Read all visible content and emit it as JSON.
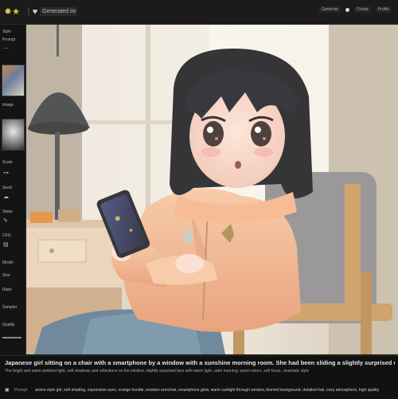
{
  "topbar": {
    "title": "Generated image",
    "right_items": [
      "Generate",
      "Create",
      "Profile"
    ]
  },
  "sidebar": {
    "labels": [
      "Style",
      "Prompt",
      "Image",
      "Scale",
      "Seed",
      "Steps",
      "CFG",
      "Model",
      "Size",
      "Ratio",
      "Sampler",
      "Quality"
    ]
  },
  "prompt": {
    "line1": "Japanese girl sitting on a chair with a smartphone by a window with a sunshine morning room. She had been sliding a slightly surprised expression on her face",
    "line2": "The bright and warm ambient light, soft shadows and reflections on the window, slightly surprised face with warm light, calm morning, warm colors, soft focus, cinematic style",
    "footer_label": "Prompt",
    "footer_text": "anime style girl, soft shading, expressive eyes, orange hoodie, wooden armchair, smartphone glow, warm sunlight through window, blurred background, detailed hair, cozy atmosphere, high quality"
  },
  "colors": {
    "background": "#151515",
    "accent_gold": "#f3c22d"
  }
}
